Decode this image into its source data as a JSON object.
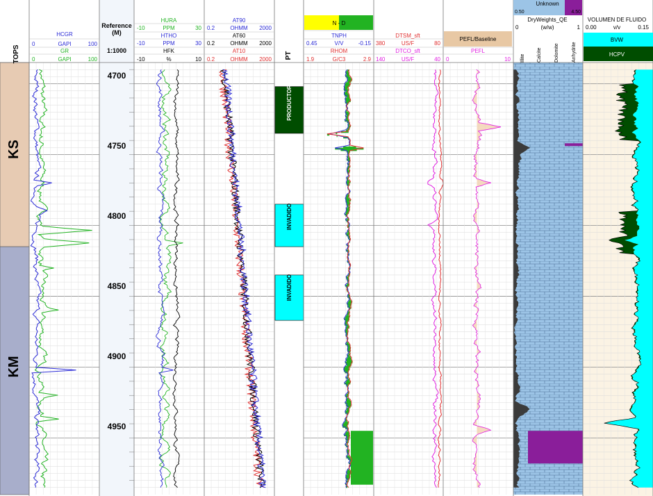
{
  "colors": {
    "blue": "#2a2ad6",
    "green": "#22b322",
    "red": "#e03030",
    "magenta": "#e020e0",
    "black": "#000000",
    "cyan": "#00ffff",
    "darkgreen": "#004d00",
    "purple": "#8a1e9a",
    "lightblue": "#9cc4e6",
    "tan": "#f3d2b0",
    "ks_fill": "#e7cbb3",
    "km_fill": "#a8aecb"
  },
  "tops": {
    "header": "TOPS",
    "zones": [
      {
        "name": "KS",
        "from": 4685,
        "to": 4815
      },
      {
        "name": "KM",
        "from": 4815,
        "to": 4990
      }
    ]
  },
  "gr_track": {
    "curves": [
      {
        "name": "HCGR",
        "min": "0",
        "unit": "GAPI",
        "max": "100",
        "color": "#2a2ad6"
      },
      {
        "name": "GR",
        "min": "0",
        "unit": "GAPI",
        "max": "100",
        "color": "#22b322"
      }
    ]
  },
  "depth_track": {
    "title": "Reference",
    "unit": "(M)",
    "scale": "1:1000",
    "labels": [
      "4700",
      "4750",
      "4800",
      "4850",
      "4900",
      "4950"
    ]
  },
  "spectral_track": {
    "curves": [
      {
        "name": "HURA",
        "min": "-10",
        "unit": "PPM",
        "max": "30",
        "color": "#22b322"
      },
      {
        "name": "HTHO",
        "min": "-10",
        "unit": "PPM",
        "max": "30",
        "color": "#2a2ad6"
      },
      {
        "name": "HFK",
        "min": "-10",
        "unit": "%",
        "max": "10",
        "color": "#000000"
      }
    ]
  },
  "resistivity_track": {
    "curves": [
      {
        "name": "AT90",
        "min": "0.2",
        "unit": "OHMM",
        "max": "2000",
        "color": "#2a2ad6"
      },
      {
        "name": "AT60",
        "min": "0.2",
        "unit": "OHMM",
        "max": "2000",
        "color": "#000000"
      },
      {
        "name": "AT10",
        "min": "0.2",
        "unit": "OHMM",
        "max": "2000",
        "color": "#e03030"
      }
    ]
  },
  "pt_track": {
    "header": "PT",
    "intervals": [
      {
        "label": "PRODUCTOR",
        "from": 4702,
        "to": 4735,
        "color": "#004d00"
      },
      {
        "label": "INVADIDO",
        "from": 4785,
        "to": 4815,
        "color": "#00ffff"
      },
      {
        "label": "INVADIDO",
        "from": 4835,
        "to": 4867,
        "color": "#00ffff"
      }
    ]
  },
  "porosity_track": {
    "fill_label": "N - D",
    "curves": [
      {
        "name": "TNPH",
        "min": "0.45",
        "unit": "V/V",
        "max": "-0.15",
        "color": "#2a2ad6"
      },
      {
        "name": "RHOM",
        "min": "1.9",
        "unit": "G/C3",
        "max": "2.9",
        "color": "#e03030"
      }
    ]
  },
  "sonic_track": {
    "curves": [
      {
        "name": "DTSM_sft",
        "min": "380",
        "unit": "US/F",
        "max": "80",
        "color": "#e03030"
      },
      {
        "name": "DTCO_sft",
        "min": "140",
        "unit": "US/F",
        "max": "40",
        "color": "#e020e0"
      }
    ]
  },
  "pefl_track": {
    "fill_label": "PEFL/Baseline",
    "curves": [
      {
        "name": "PEFL",
        "min": "0",
        "unit": "",
        "max": "10",
        "color": "#e020e0"
      }
    ]
  },
  "lithology_track": {
    "unknown_label": "Unknown",
    "unknown_min": "0.50",
    "unknown_max": "4.50",
    "title": "DryWeights_QE",
    "min": "0",
    "unit": "(w/w)",
    "max": "1",
    "minerals": [
      "Illite",
      "Calcite",
      "Dolomite",
      "Anhydrite"
    ]
  },
  "fluid_track": {
    "title": "VOLUMEN DE FLUIDO",
    "min": "0.00",
    "unit": "v/v",
    "max": "0.15",
    "legend": [
      "BVW",
      "HCPV"
    ]
  },
  "chart_data": {
    "type": "line",
    "depth_range": [
      4685,
      4990
    ],
    "depth_ticks": [
      4700,
      4750,
      4800,
      4850,
      4900,
      4950
    ],
    "series": [
      {
        "name": "GR",
        "approx_baseline": 15,
        "notable_peaks": [
          {
            "depth": 4803,
            "value": 90
          },
          {
            "depth": 4812,
            "value": 88
          },
          {
            "depth": 4920,
            "value": 25
          },
          {
            "depth": 4937,
            "value": 35
          }
        ]
      },
      {
        "name": "HCGR",
        "approx_baseline": 8,
        "notable_peaks": [
          {
            "depth": 4902,
            "value": 75
          }
        ]
      },
      {
        "name": "AT90",
        "trend": "increasing with depth",
        "approx_start_ohmm": 2,
        "approx_end_ohmm": 200
      },
      {
        "name": "TNPH",
        "approx_baseline": 0.08
      },
      {
        "name": "RHOM",
        "approx_baseline": 2.55
      },
      {
        "name": "DTCO_sft",
        "approx_baseline": 52
      },
      {
        "name": "DTSM_sft",
        "approx_baseline": 95
      },
      {
        "name": "PEFL",
        "approx_baseline": 4.8
      }
    ]
  }
}
